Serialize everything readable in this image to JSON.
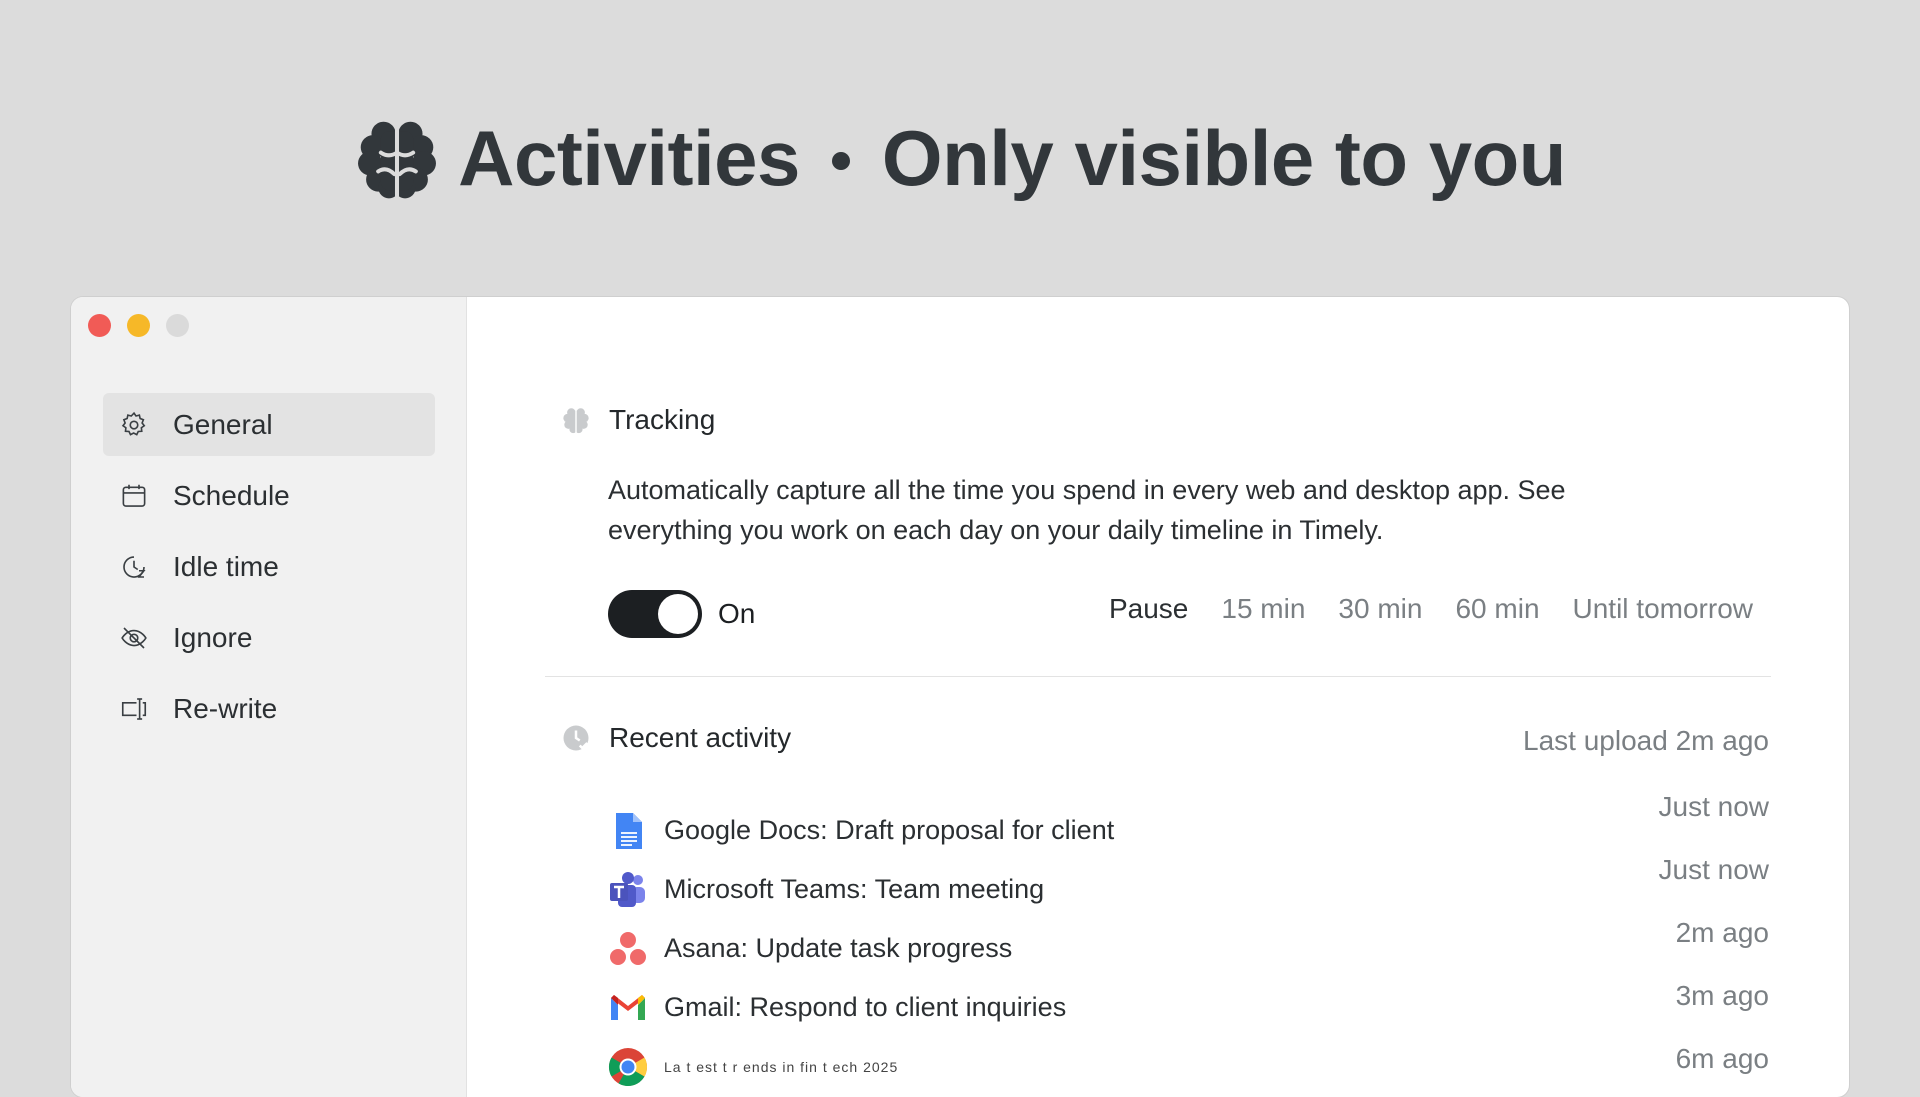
{
  "hero": {
    "title": "Activities",
    "subtitle": "Only visible to you",
    "icon": "brain-icon"
  },
  "window": {
    "traffic_lights": [
      "#f15b56",
      "#f6b828",
      "#dadada"
    ]
  },
  "sidebar": {
    "items": [
      {
        "label": "General",
        "icon": "gear-icon",
        "active": true
      },
      {
        "label": "Schedule",
        "icon": "calendar-icon",
        "active": false
      },
      {
        "label": "Idle time",
        "icon": "clock-icon",
        "active": false
      },
      {
        "label": "Ignore",
        "icon": "eye-off-icon",
        "active": false
      },
      {
        "label": "Re-write",
        "icon": "rewrite-icon",
        "active": false
      }
    ]
  },
  "tracking": {
    "title": "Tracking",
    "description": "Automatically capture all the time you spend in every web and desktop app. See everything you work on each day on your daily timeline in Timely.",
    "toggle_state": "On",
    "pause_label": "Pause",
    "pause_options": [
      "15 min",
      "30 min",
      "60 min",
      "Until tomorrow"
    ]
  },
  "recent": {
    "title": "Recent activity",
    "last_upload": "Last upload 2m ago",
    "items": [
      {
        "app_icon": "google-docs-icon",
        "text": "Google Docs: Draft proposal for client",
        "time": "Just now"
      },
      {
        "app_icon": "microsoft-teams-icon",
        "text": "Microsoft Teams: Team meeting",
        "time": "Just now"
      },
      {
        "app_icon": "asana-icon",
        "text": "Asana: Update task progress",
        "time": "2m ago"
      },
      {
        "app_icon": "gmail-icon",
        "text": "Gmail: Respond to client inquiries",
        "time": "3m ago"
      },
      {
        "app_icon": "chrome-icon",
        "text": "La   t     est t     r          ends in fin          t          ech 2025",
        "time": "6m ago"
      }
    ]
  },
  "colors": {
    "background": "#dcdcdc",
    "toggle_on": "#1c1f22",
    "muted_text": "#7a7f83"
  }
}
